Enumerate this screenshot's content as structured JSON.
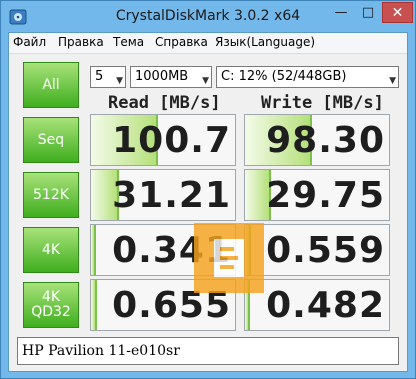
{
  "window": {
    "title": "CrystalDiskMark 3.0.2 x64",
    "controls": {
      "minimize": "—",
      "maximize": "□",
      "close": "✕"
    }
  },
  "menu": [
    "Файл",
    "Правка",
    "Тема",
    "Справка",
    "Язык(Language)"
  ],
  "controls": {
    "all_button": "All",
    "runs": "5",
    "size": "1000MB",
    "drive": "C: 12% (52/448GB)"
  },
  "headers": {
    "read": "Read [MB/s]",
    "write": "Write [MB/s]"
  },
  "tests": [
    {
      "label": "Seq",
      "read": "100.7",
      "write": "98.30",
      "read_fill": 0.45,
      "write_fill": 0.45
    },
    {
      "label": "512K",
      "read": "31.21",
      "write": "29.75",
      "read_fill": 0.18,
      "write_fill": 0.17
    },
    {
      "label": "4K",
      "read": "0.341",
      "write": "0.559",
      "read_fill": 0.02,
      "write_fill": 0.03
    },
    {
      "label": "4K\nQD32",
      "read": "0.655",
      "write": "0.482",
      "read_fill": 0.03,
      "write_fill": 0.02
    }
  ],
  "comment": "HP Pavilion 11-e010sr",
  "icons": {
    "app": "disk-icon",
    "watermark": "logo-watermark"
  }
}
